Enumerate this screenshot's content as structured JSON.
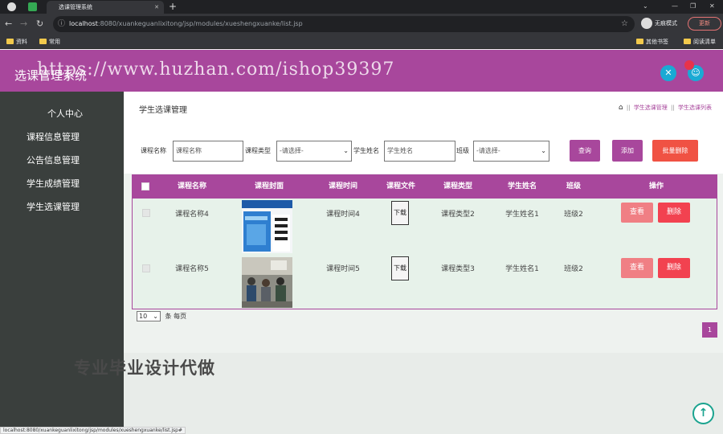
{
  "browser": {
    "tab_title": "选课管理系统",
    "url_host": "localhost",
    "url_path": ":8080/xuankeguanlixitong/jsp/modules/xueshengxuanke/list.jsp",
    "incognito_label": "无痕模式",
    "update_label": "更新",
    "bookmarks": [
      "资料",
      "常用"
    ],
    "bookmarks_right": [
      "其他书签",
      "阅读清单"
    ],
    "status_url": "localhost:8080/xuankeguanlixitong/jsp/modules/xueshengxuanke/list.jsp#"
  },
  "header": {
    "title": "选课管理系统",
    "watermark": "https://www.huzhan.com/ishop39397"
  },
  "sidebar": {
    "items": [
      "个人中心",
      "课程信息管理",
      "公告信息管理",
      "学生成绩管理",
      "学生选课管理"
    ]
  },
  "page": {
    "title": "学生选课管理",
    "breadcrumbs": [
      "学生选课管理",
      "学生选课列表"
    ]
  },
  "search": {
    "course_name_label": "课程名称",
    "course_name_placeholder": "课程名称",
    "course_type_label": "课程类型",
    "course_type_selected": "-请选择-",
    "student_name_label": "学生姓名",
    "student_name_placeholder": "学生姓名",
    "class_label": "班级",
    "class_selected": "-请选择-",
    "query_label": "查询",
    "add_label": "添加",
    "batch_delete_label": "批量删除"
  },
  "table": {
    "headers": [
      "课程名称",
      "课程封面",
      "课程时间",
      "课程文件",
      "课程类型",
      "学生姓名",
      "班级",
      "操作"
    ],
    "rows": [
      {
        "course_name": "课程名称4",
        "cover": "book-cover-image",
        "course_time": "课程时间4",
        "file_label": "下载",
        "course_type": "课程类型2",
        "student_name": "学生姓名1",
        "class": "班级2",
        "view_label": "查看",
        "delete_label": "删除"
      },
      {
        "course_name": "课程名称5",
        "cover": "classroom-photo",
        "course_time": "课程时间5",
        "file_label": "下载",
        "course_type": "课程类型3",
        "student_name": "学生姓名1",
        "class": "班级2",
        "view_label": "查看",
        "delete_label": "删除"
      }
    ]
  },
  "pagination": {
    "page_size": "10",
    "per_page_label": "条 每页",
    "current_page": "1"
  },
  "promo_text": "专业毕业设计代做",
  "colors": {
    "accent": "#a8479c",
    "sidebar": "#3a3f3d",
    "danger": "#f24250",
    "view": "#f07f84",
    "icon_blue": "#1aaad4"
  }
}
